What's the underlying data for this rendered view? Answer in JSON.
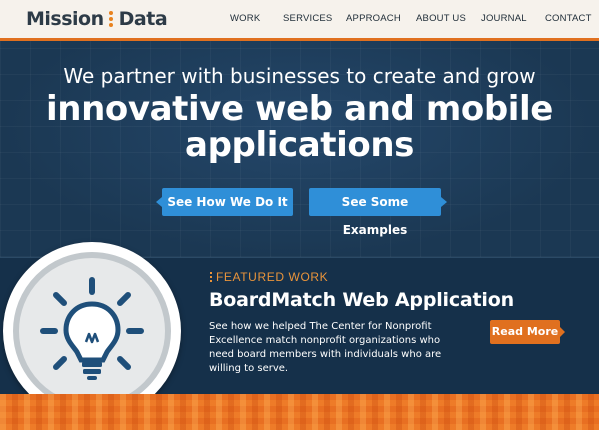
{
  "brand": {
    "name_left": "Mission",
    "name_right": "Data",
    "accent": "#e0701f"
  },
  "nav": {
    "items": [
      "WORK",
      "SERVICES",
      "APPROACH",
      "ABOUT US",
      "JOURNAL",
      "CONTACT"
    ]
  },
  "hero": {
    "line1": "We partner with businesses to create and grow",
    "line2": "innovative web and mobile applications",
    "cta_primary": "See How We Do It",
    "cta_secondary": "See Some Examples"
  },
  "featured": {
    "label": "FEATURED WORK",
    "title": "BoardMatch Web Application",
    "description": "See how we helped The Center for Nonprofit Excellence match nonprofit organizations who need board members with individuals who are willing to serve.",
    "cta": "Read More",
    "icon": "lightbulb-icon"
  },
  "colors": {
    "navy": "#1c3a56",
    "blue": "#2f8fd8",
    "orange": "#e0701f"
  }
}
